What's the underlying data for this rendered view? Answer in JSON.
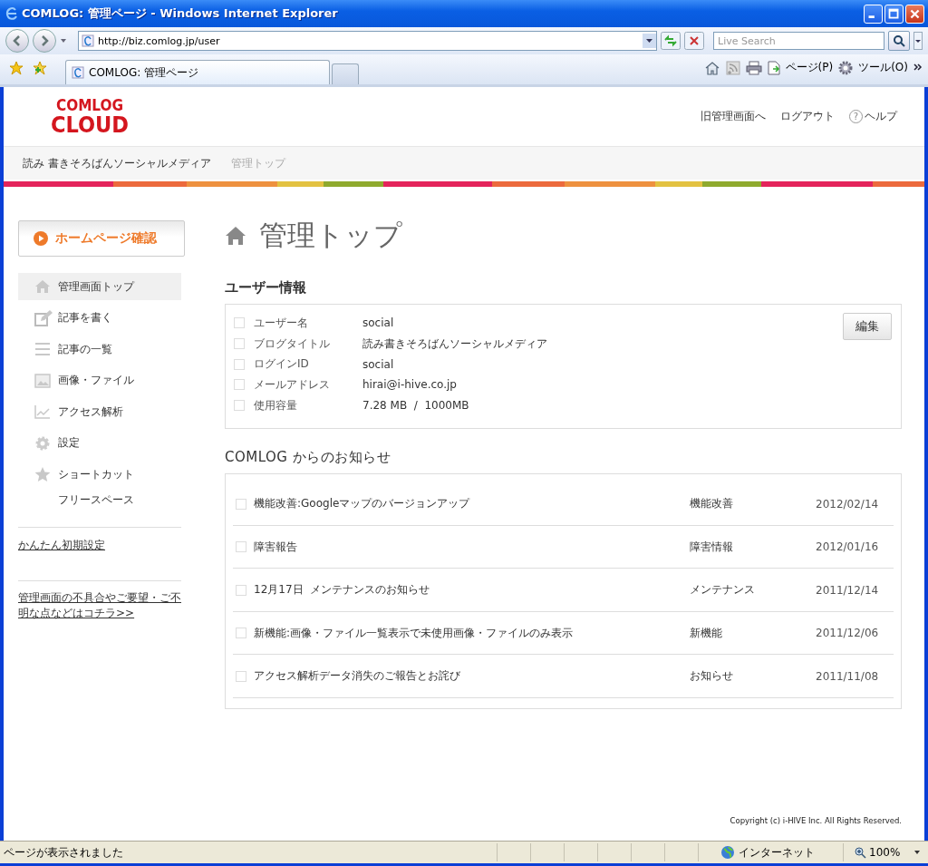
{
  "window": {
    "title": "COMLOG: 管理ページ - Windows Internet Explorer"
  },
  "address_bar": {
    "url": "http://biz.comlog.jp/user",
    "search_placeholder": "Live Search"
  },
  "tabs": [
    {
      "label": "COMLOG: 管理ページ",
      "selected": true
    }
  ],
  "command_bar": {
    "page_menu": "ページ(P)",
    "tools_menu": "ツール(O)"
  },
  "header": {
    "logo_line1": "COMLOG",
    "logo_line2": "CLOUD",
    "links": [
      "旧管理画面へ",
      "ログアウト"
    ],
    "help_icon": "?",
    "help": "ヘルプ"
  },
  "breadcrumb": [
    "読み 書きそろばんソーシャルメディア",
    "管理トップ"
  ],
  "sidebar": {
    "homepage_button": "ホームページ確認",
    "items": [
      {
        "label": "管理画面トップ",
        "kind": "home",
        "selected": true
      },
      {
        "label": "記事を書く",
        "kind": "write",
        "selected": false
      },
      {
        "label": "記事の一覧",
        "kind": "list",
        "selected": false
      },
      {
        "label": "画像・ファイル",
        "kind": "image",
        "selected": false
      },
      {
        "label": "アクセス解析",
        "kind": "chart",
        "selected": false
      },
      {
        "label": "設定",
        "kind": "settings",
        "selected": false
      },
      {
        "label": "ショートカット",
        "kind": "star",
        "selected": false,
        "children": [
          {
            "label": "フリースペース",
            "selected": false
          }
        ]
      }
    ],
    "links": [
      "かんたん初期設定",
      "管理画面の不具合やご要望・ご不明な点などはコチラ>>"
    ]
  },
  "main": {
    "title": "管理トップ",
    "user_info": {
      "heading": "ユーザー情報",
      "edit_button": "編集",
      "rows": [
        {
          "label": "ユーザー名",
          "value": "social",
          "checked": false
        },
        {
          "label": "ブログタイトル",
          "value": "読み書きそろばんソーシャルメディア",
          "checked": false
        },
        {
          "label": "ログインID",
          "value": "social",
          "checked": false
        },
        {
          "label": "メールアドレス",
          "value": "hirai@i-hive.co.jp",
          "checked": false
        },
        {
          "label": "使用容量",
          "value": "7.28 MB  /  1000MB",
          "checked": false
        }
      ]
    },
    "news": {
      "heading": "COMLOG からのお知らせ",
      "rows": [
        {
          "title": "機能改善:Googleマップのバージョンアップ",
          "category": "機能改善",
          "date": "2012/02/14",
          "checked": false
        },
        {
          "title": "障害報告",
          "category": "障害情報",
          "date": "2012/01/16",
          "checked": false
        },
        {
          "title": "12月17日  メンテナンスのお知らせ",
          "category": "メンテナンス",
          "date": "2011/12/14",
          "checked": false
        },
        {
          "title": "新機能:画像・ファイル一覧表示で未使用画像・ファイルのみ表示",
          "category": "新機能",
          "date": "2011/12/06",
          "checked": false
        },
        {
          "title": "アクセス解析データ消失のご報告とお詫び",
          "category": "お知らせ",
          "date": "2011/11/08",
          "checked": false
        }
      ]
    }
  },
  "footer": {
    "copyright": "Copyright (c) i-HIVE Inc. All Rights Reserved."
  },
  "status_bar": {
    "text": "ページが表示されました",
    "zone": "インターネット",
    "zoom": "100%"
  }
}
